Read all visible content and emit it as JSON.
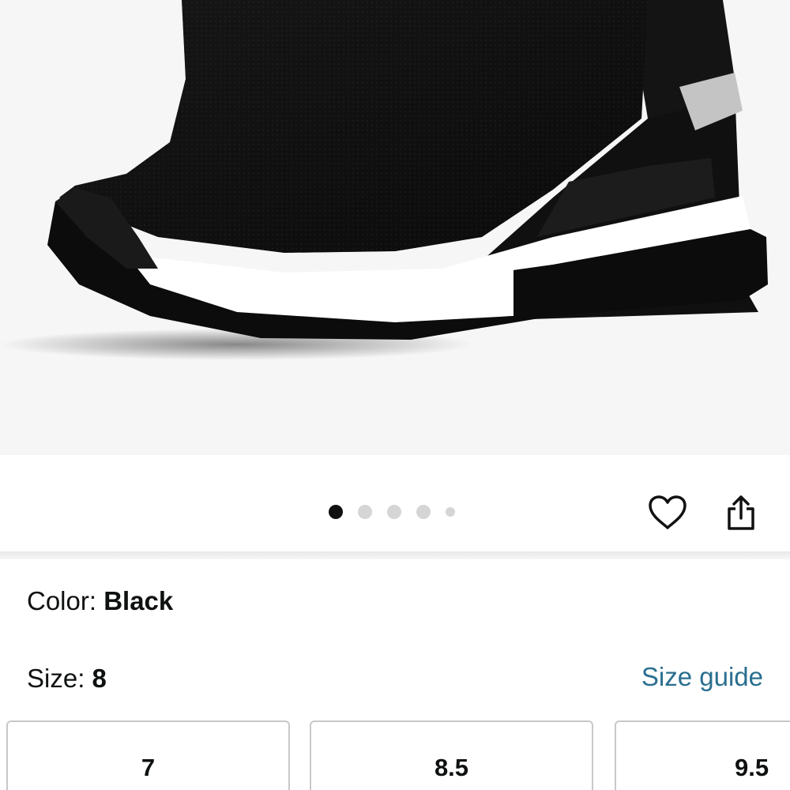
{
  "product_image": {
    "label": "product-photo-black-knit-wedge-sneaker",
    "colors": {
      "background": "#f6f6f6",
      "upper": "#111111",
      "sole_stripe": "#ffffff",
      "accent": "#c4c4c4"
    }
  },
  "gallery": {
    "image_count": 5,
    "active_index": 0
  },
  "actions": {
    "favorite_icon": "heart-icon",
    "share_icon": "share-icon"
  },
  "color": {
    "label": "Color: ",
    "value": "Black"
  },
  "size": {
    "label": "Size: ",
    "value": "8",
    "guide_link": "Size guide"
  },
  "size_options": [
    "7",
    "8.5",
    "9.5"
  ],
  "theme": {
    "link_color": "#2a6f8f",
    "active_dot": "#111111",
    "inactive_dot": "#d5d5d5"
  }
}
